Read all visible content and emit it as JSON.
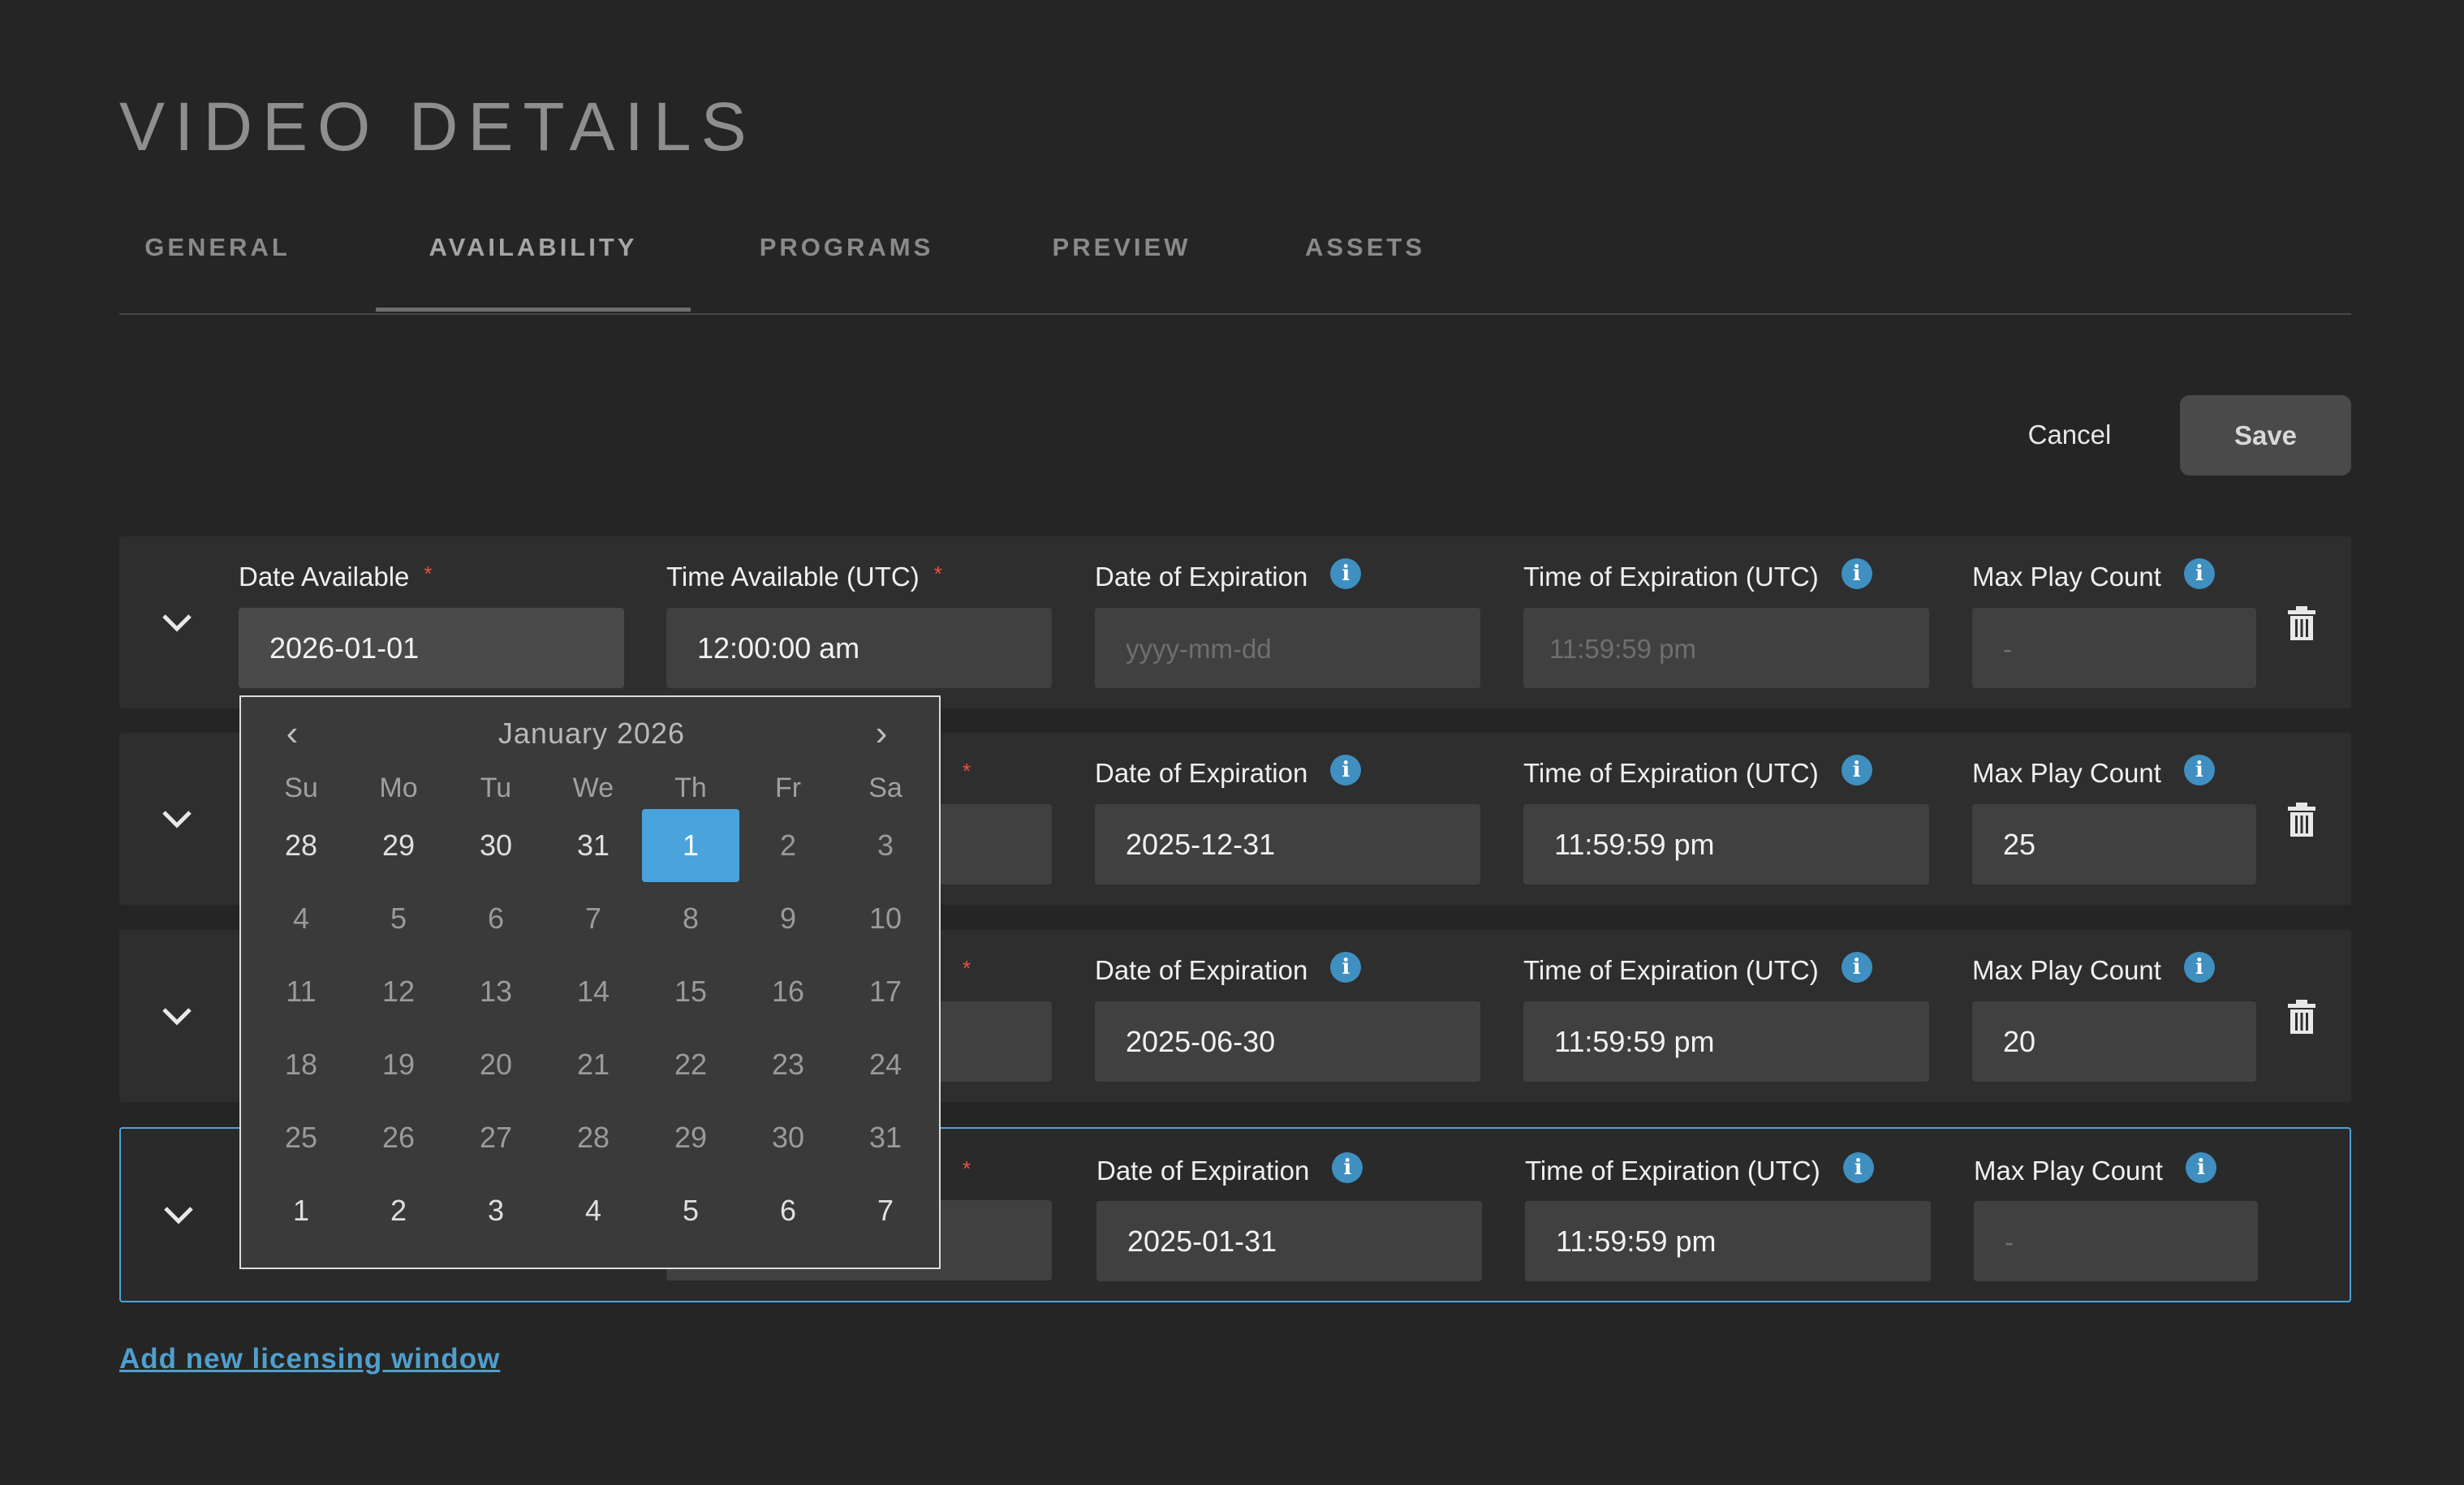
{
  "page": {
    "title": "VIDEO DETAILS"
  },
  "tabs": [
    "GENERAL",
    "AVAILABILITY",
    "PROGRAMS",
    "PREVIEW",
    "ASSETS"
  ],
  "active_tab": "AVAILABILITY",
  "actions": {
    "cancel": "Cancel",
    "save": "Save"
  },
  "labels": {
    "date_available": "Date Available",
    "time_available": "Time Available (UTC)",
    "date_expiration": "Date of Expiration",
    "time_expiration": "Time of Expiration (UTC)",
    "max_play": "Max Play Count",
    "required": "*",
    "info": "i"
  },
  "windows": [
    {
      "date_available": "2026-01-01",
      "time_available": "12:00:00 am",
      "date_expiration": "",
      "date_expiration_placeholder": "yyyy-mm-dd",
      "time_expiration": "",
      "time_expiration_placeholder": "11:59:59 pm",
      "max_play": "",
      "max_play_placeholder": "-"
    },
    {
      "date_expiration": "2025-12-31",
      "time_expiration": "11:59:59 pm",
      "max_play": "25"
    },
    {
      "date_expiration": "2025-06-30",
      "time_expiration": "11:59:59 pm",
      "max_play": "20"
    },
    {
      "date_expiration": "2025-01-31",
      "time_expiration": "11:59:59 pm",
      "max_play": "",
      "max_play_placeholder": "-"
    }
  ],
  "calendar": {
    "month_label": "January 2026",
    "weekdays": [
      "Su",
      "Mo",
      "Tu",
      "We",
      "Th",
      "Fr",
      "Sa"
    ],
    "weeks": [
      [
        "28",
        "29",
        "30",
        "31",
        "1",
        "2",
        "3"
      ],
      [
        "4",
        "5",
        "6",
        "7",
        "8",
        "9",
        "10"
      ],
      [
        "11",
        "12",
        "13",
        "14",
        "15",
        "16",
        "17"
      ],
      [
        "18",
        "19",
        "20",
        "21",
        "22",
        "23",
        "24"
      ],
      [
        "25",
        "26",
        "27",
        "28",
        "29",
        "30",
        "31"
      ],
      [
        "1",
        "2",
        "3",
        "4",
        "5",
        "6",
        "7"
      ]
    ],
    "selected": "1"
  },
  "add_link": "Add new licensing window",
  "colors": {
    "accent": "#4aa3dc",
    "info": "#3f8fc0",
    "required": "#e5533f",
    "link": "#4f9fcd"
  }
}
